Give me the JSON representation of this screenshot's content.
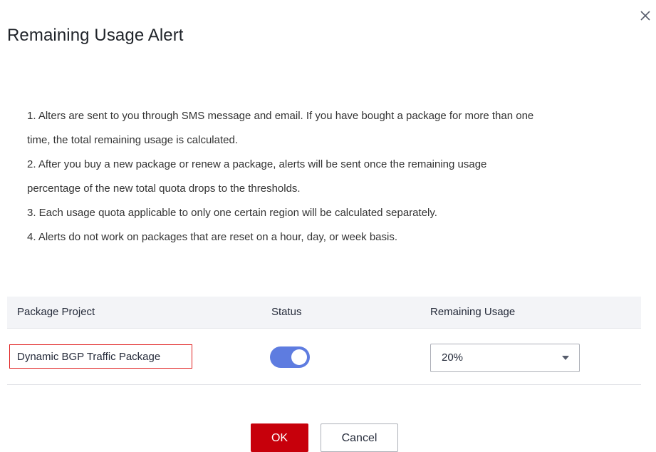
{
  "dialog": {
    "title": "Remaining Usage Alert",
    "notes": [
      "1. Alters are sent to you through SMS message and email. If you have bought a package for more than one",
      "time, the total remaining usage is calculated.",
      "2. After you buy a new package or renew a package, alerts will be sent once the remaining usage",
      "percentage of the new total quota drops to the thresholds.",
      "3. Each usage quota applicable to only one certain region will be calculated separately.",
      "4. Alerts do not work on packages that are reset on a hour, day, or week basis."
    ],
    "table": {
      "headers": {
        "project": "Package Project",
        "status": "Status",
        "remaining": "Remaining Usage"
      },
      "rows": [
        {
          "project": "Dynamic BGP Traffic Package",
          "status_on": true,
          "remaining": "20%"
        }
      ]
    },
    "buttons": {
      "ok": "OK",
      "cancel": "Cancel"
    },
    "icons": {
      "close": "close-icon",
      "dropdown": "chevron-down-icon"
    },
    "colors": {
      "primary": "#c7000b",
      "toggle_on": "#5e7ce0",
      "highlight_border": "#e02020"
    }
  }
}
